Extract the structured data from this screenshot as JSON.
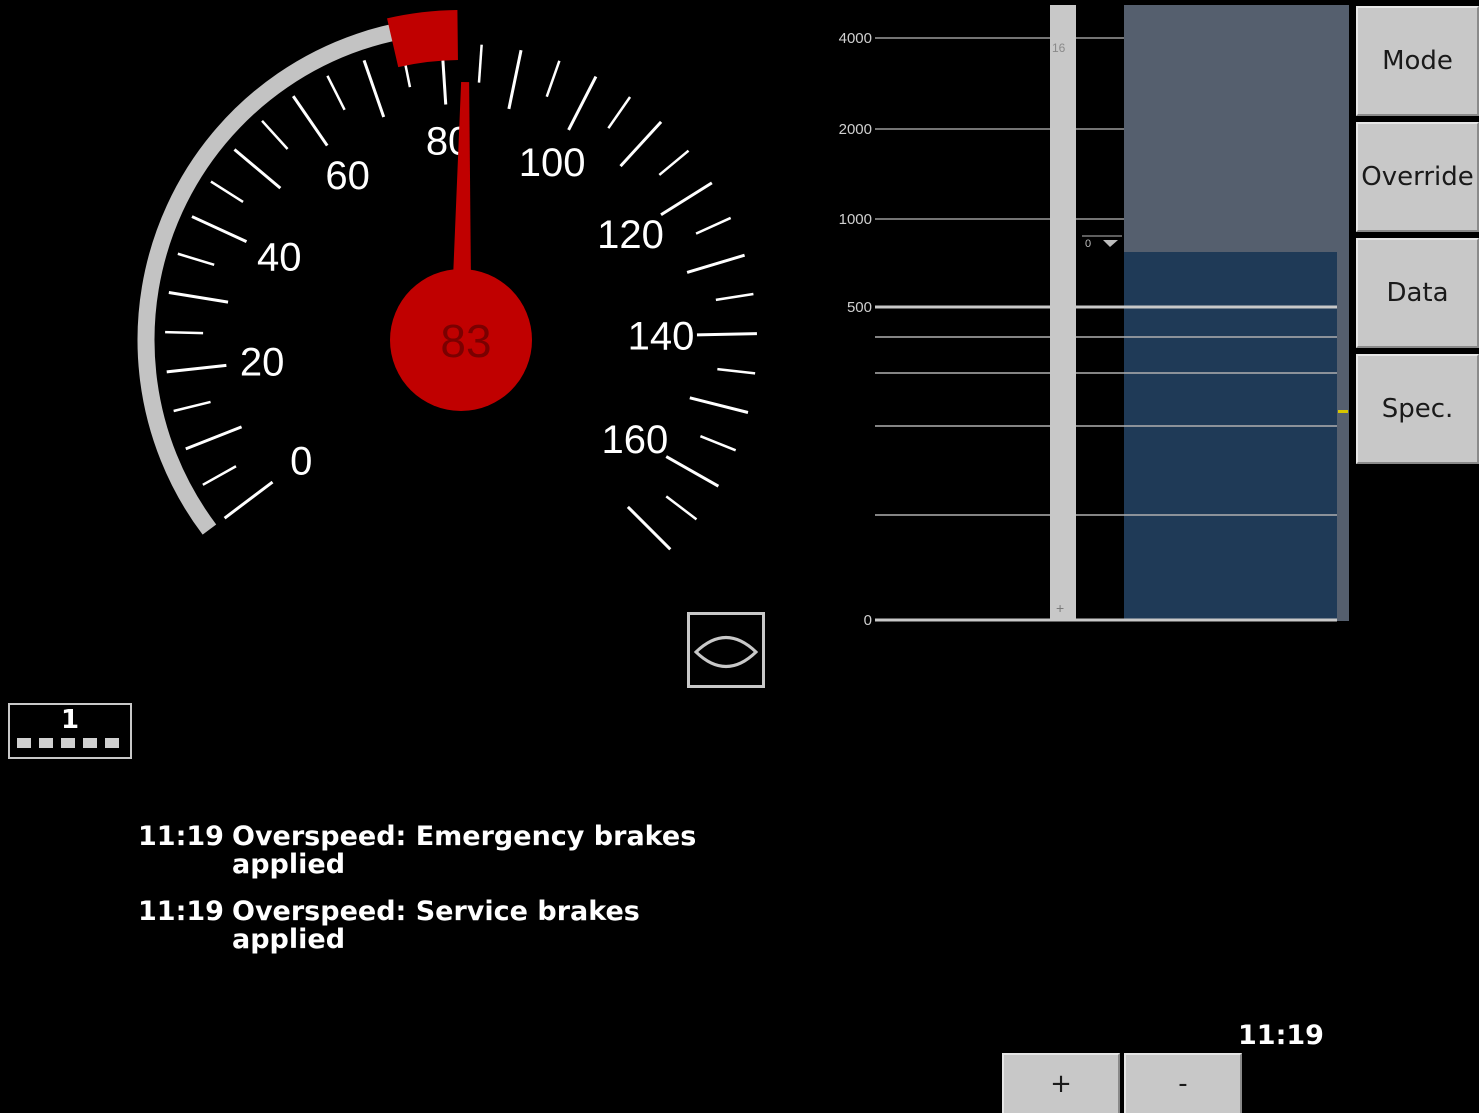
{
  "speedometer": {
    "current_speed": 83,
    "current_speed_label": "83",
    "min_speed": 0,
    "max_speed": 170,
    "permitted_speed": 80,
    "overspeed_band": [
      80,
      100
    ],
    "tick_labels": [
      "0",
      "20",
      "40",
      "60",
      "80",
      "100",
      "120",
      "140",
      "160"
    ],
    "colors": {
      "overspeed": "#c00000",
      "needle": "#c00000",
      "arc": "#c3c3c3",
      "hub_text": "#7a0000"
    }
  },
  "mode_symbol": {
    "icon": "full-supervision-mode-icon"
  },
  "level_indicator": {
    "label": "1"
  },
  "planning_area": {
    "distance_labels": [
      "4000",
      "2000",
      "1000",
      "500",
      "0"
    ],
    "target_marker": "16",
    "gradient_label": "0",
    "plus_glyph": "+",
    "colors": {
      "pasp": "#555f6e",
      "pasp_indication": "#1f3a57",
      "track": "#c8c8c8",
      "grid": "#9a9a9a"
    }
  },
  "menu": {
    "buttons": [
      {
        "label": "Mode",
        "name": "mode-button"
      },
      {
        "label": "Override",
        "name": "override-button"
      },
      {
        "label": "Data",
        "name": "data-button"
      },
      {
        "label": "Spec.",
        "name": "spec-button"
      }
    ]
  },
  "messages": [
    {
      "time": "11:19",
      "text": "Overspeed: Emergency brakes applied"
    },
    {
      "time": "11:19",
      "text": "Overspeed: Service brakes applied"
    }
  ],
  "zoom": {
    "plus_label": "+",
    "minus_label": "-"
  },
  "clock": "11:19"
}
